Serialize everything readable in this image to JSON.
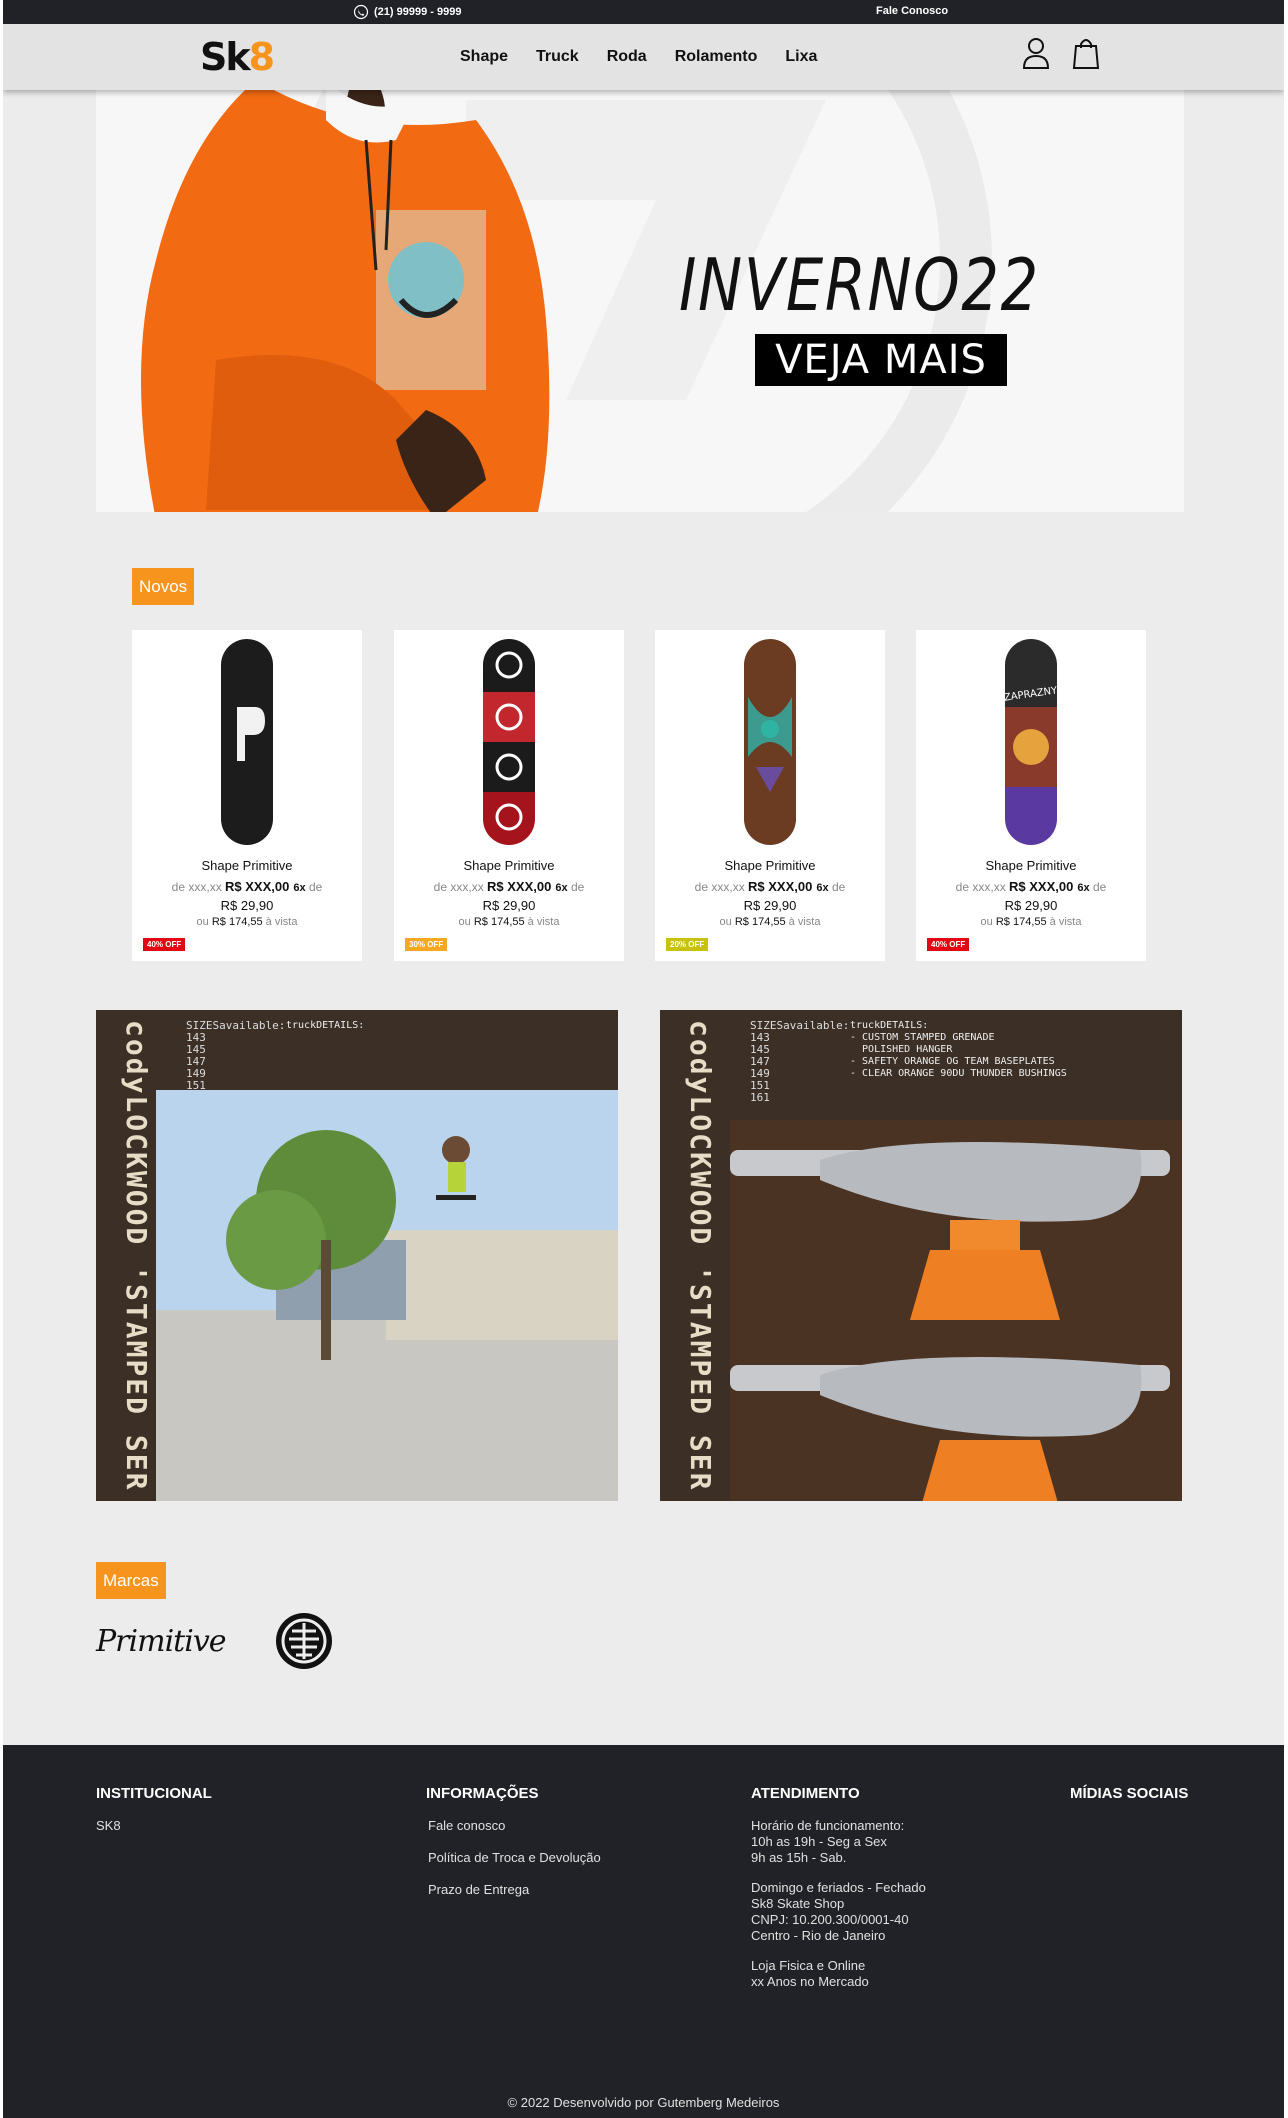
{
  "topbar": {
    "phone": "(21) 99999 - 9999",
    "contact": "Fale Conosco"
  },
  "header": {
    "logo_s": "Sk",
    "logo_8": "8",
    "nav": [
      "Shape",
      "Truck",
      "Roda",
      "Rolamento",
      "Lixa"
    ]
  },
  "banner": {
    "headline": "INVERNO22",
    "cta": "VEJA MAIS"
  },
  "novos": {
    "title": "Novos",
    "products": [
      {
        "name": "Shape Primitive",
        "old_prefix": "de xxx,xx",
        "price": "R$ XXX,00",
        "times": "6x",
        "de": "de",
        "installment": "R$ 29,90",
        "cash_prefix": "ou",
        "cash": "R$ 174,55",
        "cash_suffix": "à vista",
        "badge": "40% OFF",
        "badge_color": "#e30613"
      },
      {
        "name": "Shape Primitive",
        "old_prefix": "de xxx,xx",
        "price": "R$ XXX,00",
        "times": "6x",
        "de": "de",
        "installment": "R$ 29,90",
        "cash_prefix": "ou",
        "cash": "R$ 174,55",
        "cash_suffix": "à vista",
        "badge": "30% OFF",
        "badge_color": "#f7a823"
      },
      {
        "name": "Shape Primitive",
        "old_prefix": "de xxx,xx",
        "price": "R$ XXX,00",
        "times": "6x",
        "de": "de",
        "installment": "R$ 29,90",
        "cash_prefix": "ou",
        "cash": "R$ 174,55",
        "cash_suffix": "à vista",
        "badge": "20% OFF",
        "badge_color": "#c8c20c"
      },
      {
        "name": "Shape Primitive",
        "old_prefix": "de xxx,xx",
        "price": "R$ XXX,00",
        "times": "6x",
        "de": "de",
        "installment": "R$ 29,90",
        "cash_prefix": "ou",
        "cash": "R$ 174,55",
        "cash_suffix": "à vista",
        "badge": "40% OFF",
        "badge_color": "#e30613"
      }
    ]
  },
  "promos": [
    {
      "side": "codyLOCKWOOD 'STAMPED SER",
      "sizes_title": "SIZESavailable:",
      "sizes": [
        "143",
        "145",
        "147",
        "149",
        "151"
      ],
      "details_title": "truckDETAILS:"
    },
    {
      "side": "codyLOCKWOOD 'STAMPED SER",
      "sizes_title": "SIZESavailable:",
      "sizes": [
        "143",
        "145",
        "147",
        "149",
        "151",
        "161"
      ],
      "details_title": "truckDETAILS:",
      "details": [
        "- CUSTOM STAMPED GRENADE",
        "  POLISHED HANGER",
        "- SAFETY ORANGE OG TEAM BASEPLATES",
        "- CLEAR ORANGE 90DU THUNDER BUSHINGS"
      ]
    }
  ],
  "marcas": {
    "title": "Marcas",
    "brands": [
      "Primitive",
      "Element"
    ]
  },
  "footer": {
    "institucional": {
      "title": "INSTITUCIONAL",
      "items": [
        "SK8"
      ]
    },
    "informacoes": {
      "title": "INFORMAÇÕES",
      "items": [
        "Fale conosco",
        "Política de Troca e Devolução",
        "Prazo de Entrega"
      ]
    },
    "atendimento": {
      "title": "ATENDIMENTO",
      "block1": [
        "Horário de funcionamento:",
        "10h as 19h - Seg a Sex",
        "9h as 15h - Sab."
      ],
      "block2": [
        "Domingo e feriados - Fechado",
        "Sk8 Skate Shop",
        "CNPJ: 10.200.300/0001-40",
        "Centro - Rio de Janeiro"
      ],
      "block3": [
        "Loja Fisica e Online",
        "xx Anos no Mercado"
      ]
    },
    "midias": {
      "title": "MÍDIAS SOCIAIS"
    },
    "copyright": "© 2022 Desenvolvido por Gutemberg Medeiros"
  },
  "colors": {
    "accent": "#f7941d",
    "dark": "#202227",
    "page_bg": "#ececec"
  }
}
